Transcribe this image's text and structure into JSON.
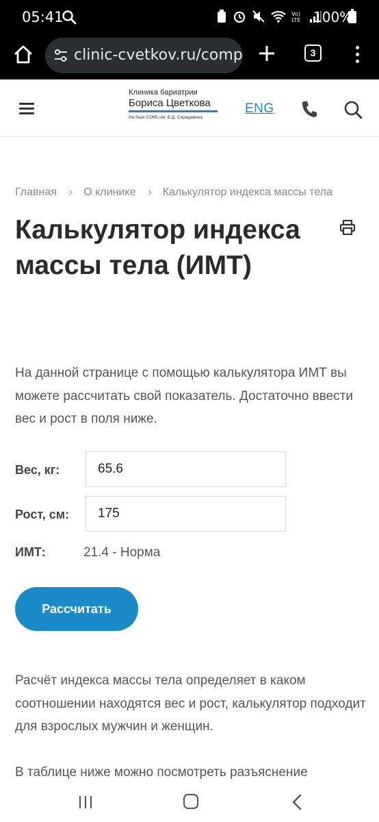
{
  "status_bar": {
    "time": "05:41",
    "battery": "100%"
  },
  "browser": {
    "url": "clinic-cvetkov.ru/compa",
    "tab_count": "3"
  },
  "site_header": {
    "logo_line1": "Клиника бариатрии",
    "logo_line2": "Бориса Цветкова",
    "logo_line3": "На базе СОКБ им. В.Д. Середавина",
    "language_link": "ENG"
  },
  "breadcrumb": {
    "items": [
      "Главная",
      "О клинике",
      "Калькулятор индекса массы тела"
    ],
    "separator": "›"
  },
  "page": {
    "title": "Калькулятор индекса массы тела (ИМТ)",
    "intro": "На данной странице с помощью калькулятора ИМТ вы можете рассчитать свой показатель. Достаточно ввести вес и рост в поля ниже."
  },
  "form": {
    "weight_label": "Вес, кг:",
    "weight_value": "65.6",
    "height_label": "Рост, см:",
    "height_value": "175",
    "bmi_label": "ИМТ:",
    "bmi_result": "21.4 - Норма",
    "submit_label": "Рассчитать"
  },
  "content": {
    "paragraph2": "Расчёт индекса массы тела определяет в каком соотношении находятся вес и рост, калькулятор подходит для взрослых мужчин и женщин.",
    "paragraph3": "В таблице ниже можно посмотреть разъяснение"
  },
  "colors": {
    "accent": "#1a8ac8",
    "text": "#333333"
  }
}
